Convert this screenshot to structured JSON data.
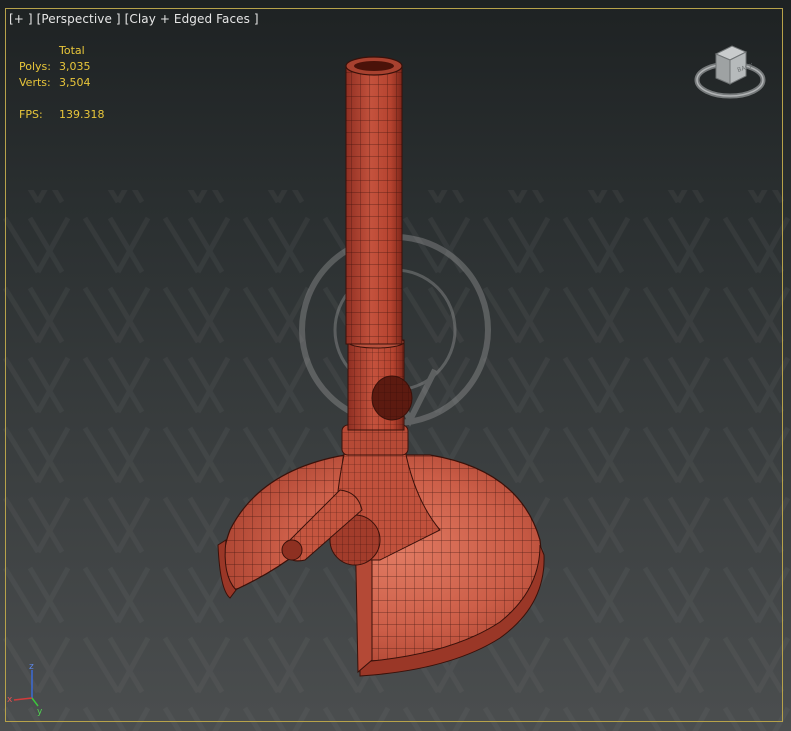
{
  "viewport": {
    "label_plus": "[+ ]",
    "label_view": "[Perspective ]",
    "label_shading": "[Clay + Edged Faces ]"
  },
  "stats": {
    "header": "Total",
    "polys_label": "Polys:",
    "polys_value": "3,035",
    "verts_label": "Verts:",
    "verts_value": "3,504",
    "fps_label": "FPS:",
    "fps_value": "139.318"
  },
  "viewcube": {
    "face_label": "BACK",
    "icon": "viewcube-icon"
  },
  "axis_gizmo": {
    "z_label": "z",
    "x_label": "x",
    "y_label": "y",
    "icon": "axis-tripod-icon"
  },
  "colors": {
    "frame": "#b7a24a",
    "stats_text": "#e8c63a",
    "model": "#c65a47",
    "model_edge": "#2a0b07",
    "watermark": "#9a9a9a"
  }
}
